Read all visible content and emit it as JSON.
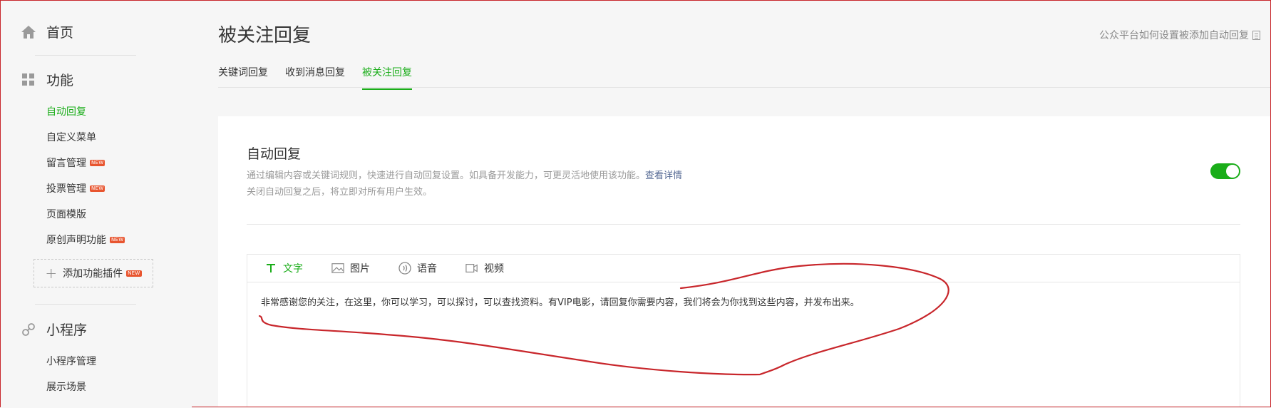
{
  "sidebar": {
    "home": {
      "label": "首页",
      "icon": "home-icon"
    },
    "features": {
      "label": "功能",
      "icon": "grid-icon"
    },
    "feature_items": [
      {
        "label": "自动回复",
        "active": true,
        "new": false
      },
      {
        "label": "自定义菜单",
        "active": false,
        "new": false
      },
      {
        "label": "留言管理",
        "active": false,
        "new": true
      },
      {
        "label": "投票管理",
        "active": false,
        "new": true
      },
      {
        "label": "页面模版",
        "active": false,
        "new": false
      },
      {
        "label": "原创声明功能",
        "active": false,
        "new": true
      }
    ],
    "add_plugin": {
      "label": "添加功能插件",
      "badge": "NEW"
    },
    "new_badge": "NEW",
    "miniprogram": {
      "label": "小程序",
      "icon": "link-icon"
    },
    "miniprogram_items": [
      {
        "label": "小程序管理"
      },
      {
        "label": "展示场景"
      }
    ]
  },
  "header": {
    "title": "被关注回复",
    "help_link": "公众平台如何设置被添加自动回复"
  },
  "tabs": [
    {
      "label": "关键词回复",
      "active": false
    },
    {
      "label": "收到消息回复",
      "active": false
    },
    {
      "label": "被关注回复",
      "active": true
    }
  ],
  "panel": {
    "title": "自动回复",
    "desc_line1": "通过编辑内容或关键词规则，快速进行自动回复设置。如具备开发能力，可更灵活地使用该功能。",
    "desc_more": "查看详情",
    "desc_line2": "关闭自动回复之后，将立即对所有用户生效。",
    "toggle_on": true
  },
  "editor": {
    "tools": [
      {
        "label": "文字",
        "icon": "text-icon",
        "active": true
      },
      {
        "label": "图片",
        "icon": "image-icon",
        "active": false
      },
      {
        "label": "语音",
        "icon": "voice-icon",
        "active": false
      },
      {
        "label": "视频",
        "icon": "video-icon",
        "active": false
      }
    ],
    "content": "非常感谢您的关注，在这里，你可以学习，可以探讨，可以查找资料。有VIP电影，请回复你需要内容，我们将会为你找到这些内容，并发布出来。"
  },
  "colors": {
    "accent": "#1aad19",
    "annotation": "#c8262b",
    "link": "#576b95",
    "badge": "#e8552f"
  }
}
